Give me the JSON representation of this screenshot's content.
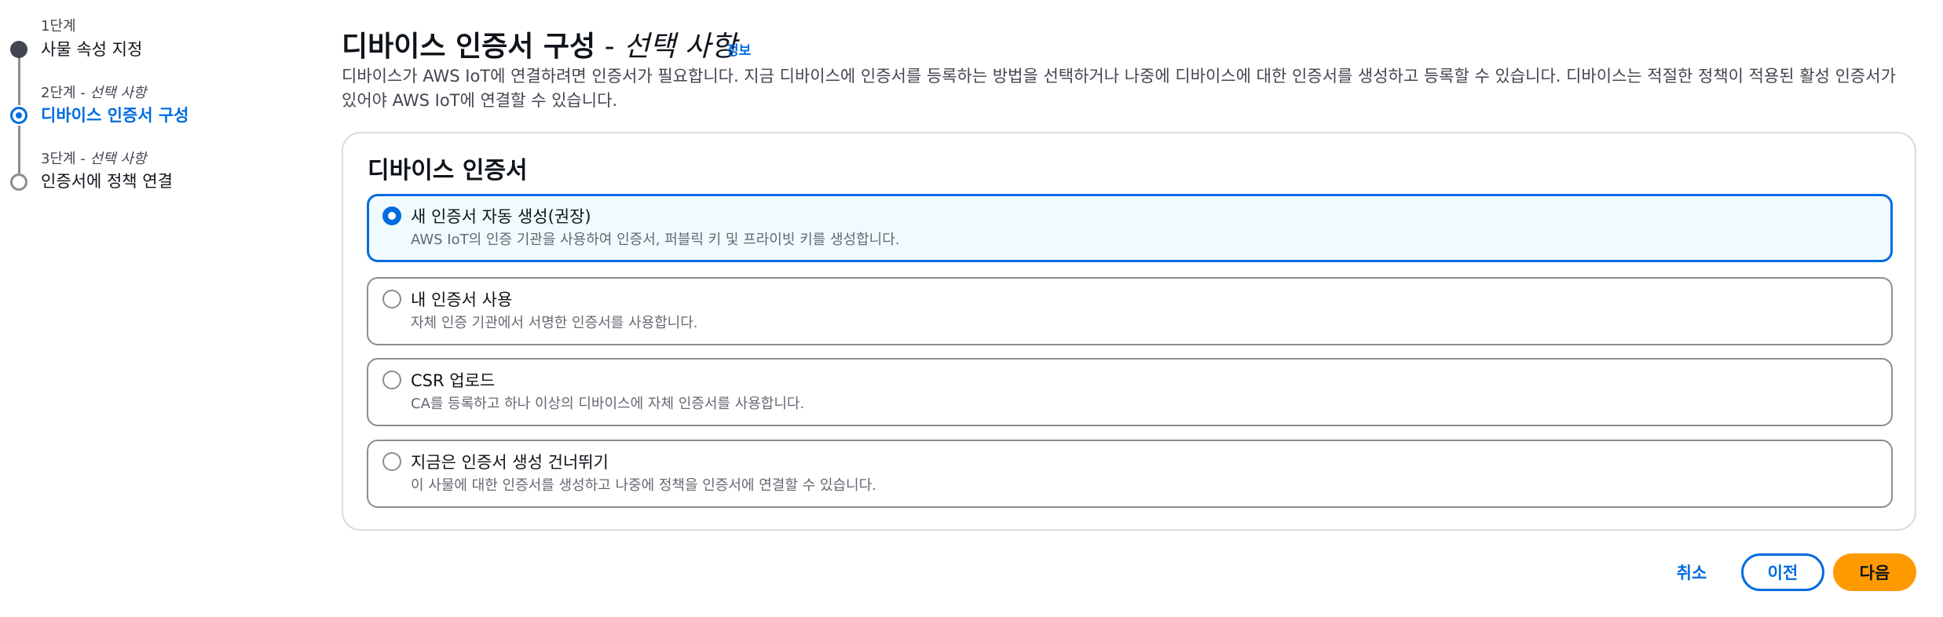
{
  "stepper": {
    "steps": [
      {
        "number": "1단계",
        "optional": "",
        "title": "사물 속성 지정",
        "state": "done"
      },
      {
        "number": "2단계 - ",
        "optional": "선택 사항",
        "title": "디바이스 인증서 구성",
        "state": "active"
      },
      {
        "number": "3단계 - ",
        "optional": "선택 사항",
        "title": "인증서에 정책 연결",
        "state": "pending"
      }
    ]
  },
  "header": {
    "title": "디바이스 인증서 구성",
    "dash": " - ",
    "optional": "선택 사항",
    "info_link": "정보",
    "description": "디바이스가 AWS IoT에 연결하려면 인증서가 필요합니다. 지금 디바이스에 인증서를 등록하는 방법을 선택하거나 나중에 디바이스에 대한 인증서를 생성하고 등록할 수 있습니다. 디바이스는 적절한 정책이 적용된 활성 인증서가 있어야 AWS IoT에 연결할 수 있습니다."
  },
  "container": {
    "title": "디바이스 인증서",
    "options": [
      {
        "label": "새 인증서 자동 생성(권장)",
        "description": "AWS IoT의 인증 기관을 사용하여 인증서, 퍼블릭 키 및 프라이빗 키를 생성합니다.",
        "selected": true
      },
      {
        "label": "내 인증서 사용",
        "description": "자체 인증 기관에서 서명한 인증서를 사용합니다.",
        "selected": false
      },
      {
        "label": "CSR 업로드",
        "description": "CA를 등록하고 하나 이상의 디바이스에 자체 인증서를 사용합니다.",
        "selected": false
      },
      {
        "label": "지금은 인증서 생성 건너뛰기",
        "description": "이 사물에 대한 인증서를 생성하고 나중에 정책을 인증서에 연결할 수 있습니다.",
        "selected": false
      }
    ]
  },
  "actions": {
    "cancel": "취소",
    "previous": "이전",
    "next": "다음"
  },
  "colors": {
    "accent": "#006ce0",
    "primary_button": "#ff9900",
    "selected_tile_bg": "#f0fbff"
  }
}
